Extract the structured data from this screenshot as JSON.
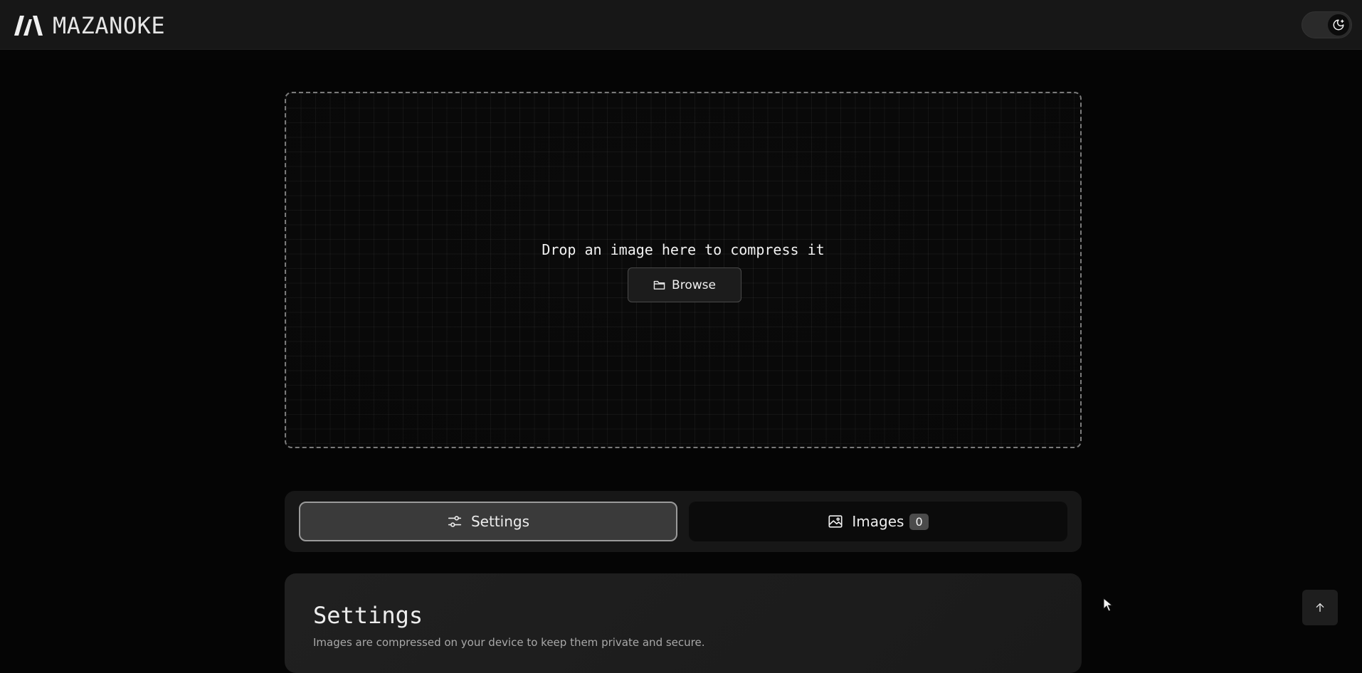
{
  "app": {
    "name": "MAZANOKE"
  },
  "header": {
    "theme_toggle_icon": "moon-icon"
  },
  "dropzone": {
    "prompt": "Drop an image here to compress it",
    "browse_label": "Browse",
    "browse_icon": "folder-icon"
  },
  "tabs": [
    {
      "label": "Settings",
      "icon": "sliders-icon",
      "active": true
    },
    {
      "label": "Images",
      "icon": "image-icon",
      "active": false,
      "count": "0"
    }
  ],
  "settings": {
    "title": "Settings",
    "description": "Images are compressed on your device to keep them private and secure."
  },
  "scroll_top": {
    "icon": "arrow-up-icon"
  }
}
